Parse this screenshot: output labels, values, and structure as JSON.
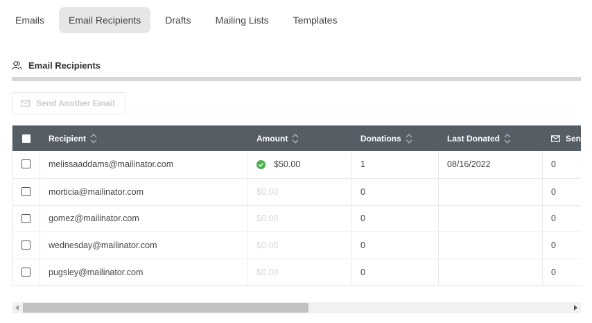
{
  "tabs": [
    {
      "label": "Emails",
      "active": false
    },
    {
      "label": "Email Recipients",
      "active": true
    },
    {
      "label": "Drafts",
      "active": false
    },
    {
      "label": "Mailing Lists",
      "active": false
    },
    {
      "label": "Templates",
      "active": false
    }
  ],
  "section": {
    "title": "Email Recipients",
    "icon": "users-icon"
  },
  "send_button": {
    "label": "Send Another Email",
    "icon": "envelope-icon"
  },
  "table": {
    "columns": {
      "recipient": "Recipient",
      "amount": "Amount",
      "donations": "Donations",
      "last_donated": "Last Donated",
      "sent": "Sent"
    },
    "rows": [
      {
        "recipient": "melissaaddams@mailinator.com",
        "amount": "$50.00",
        "paid": true,
        "donations": "1",
        "last_donated": "08/16/2022",
        "sent": "0"
      },
      {
        "recipient": "morticia@mailinator.com",
        "amount": "$0.00",
        "paid": false,
        "donations": "0",
        "last_donated": "",
        "sent": "0"
      },
      {
        "recipient": "gomez@mailinator.com",
        "amount": "$0.00",
        "paid": false,
        "donations": "0",
        "last_donated": "",
        "sent": "0"
      },
      {
        "recipient": "wednesday@mailinator.com",
        "amount": "$0.00",
        "paid": false,
        "donations": "0",
        "last_donated": "",
        "sent": "0"
      },
      {
        "recipient": "pugsley@mailinator.com",
        "amount": "$0.00",
        "paid": false,
        "donations": "0",
        "last_donated": "",
        "sent": "0"
      }
    ]
  },
  "colors": {
    "header_bg": "#555d65",
    "success": "#4caf50",
    "active_tab": "#e4e6e8"
  }
}
